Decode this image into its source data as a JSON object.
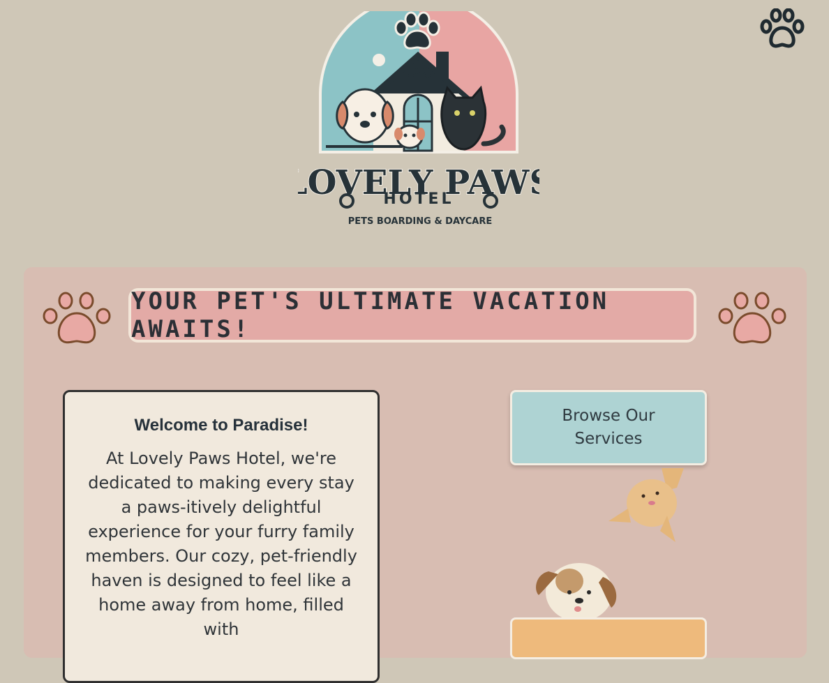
{
  "header": {
    "menu_icon": "paw-icon",
    "logo": {
      "title": "LOVELY PAWS",
      "subtitle": "HOTEL",
      "tagline": "PETS BOARDING & DAYCARE"
    }
  },
  "banner": {
    "text": "Your Pet's Ultimate Vacation Awaits!",
    "paw_icon": "paw-icon"
  },
  "welcome": {
    "title": "Welcome to Paradise!",
    "body": "At Lovely Paws Hotel, we're dedicated to making every stay a paws-itively delightful experience for your furry family members. Our cozy, pet-friendly haven is designed to feel like a home away from home, filled with"
  },
  "actions": {
    "services_label": "Browse Our Services"
  },
  "colors": {
    "page_bg": "#cfc7b7",
    "panel_bg": "#d8bdb2",
    "banner_bg": "#e3aaa6",
    "card_bg": "#f1e9dd",
    "services_btn_bg": "#aed3d3",
    "second_btn_bg": "#eeba7c"
  }
}
